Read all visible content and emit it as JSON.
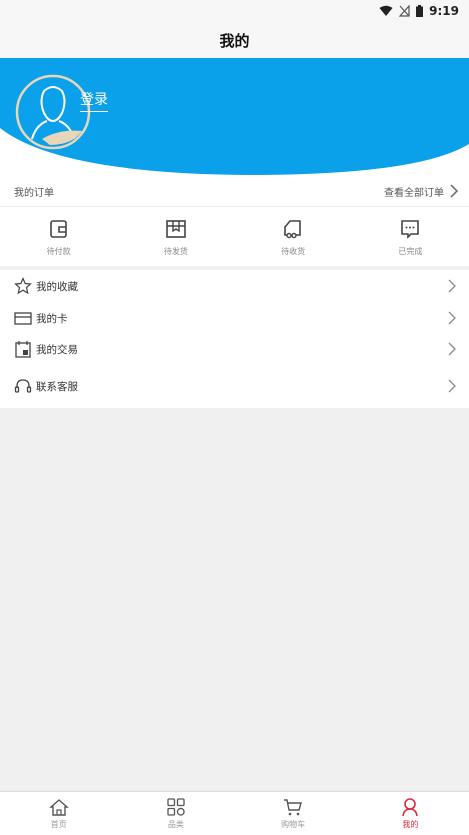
{
  "status_bar": {
    "time": "9:19",
    "icons": [
      "wifi-icon",
      "no-sim-icon",
      "battery-icon"
    ]
  },
  "header": {
    "title": "我的"
  },
  "profile": {
    "login_label": "登录",
    "accent_color": "#0aa0ea"
  },
  "orders": {
    "title": "我的订单",
    "view_all": "查看全部订单",
    "items": [
      {
        "label": "待付款",
        "icon": "wallet-icon"
      },
      {
        "label": "待发货",
        "icon": "box-icon"
      },
      {
        "label": "待收货",
        "icon": "truck-icon"
      },
      {
        "label": "已完成",
        "icon": "chat-icon"
      }
    ]
  },
  "menu": {
    "items": [
      {
        "label": "我的收藏",
        "icon": "star-icon"
      },
      {
        "label": "我的卡",
        "icon": "card-icon"
      },
      {
        "label": "我的交易",
        "icon": "transaction-icon"
      },
      {
        "label": "联系客服",
        "icon": "headset-icon"
      }
    ]
  },
  "bottom_nav": {
    "items": [
      {
        "label": "首页",
        "icon": "home-icon"
      },
      {
        "label": "品类",
        "icon": "category-icon"
      },
      {
        "label": "购物车",
        "icon": "cart-icon"
      },
      {
        "label": "我的",
        "icon": "user-icon",
        "active": true
      }
    ],
    "active_color": "#e0263b"
  }
}
